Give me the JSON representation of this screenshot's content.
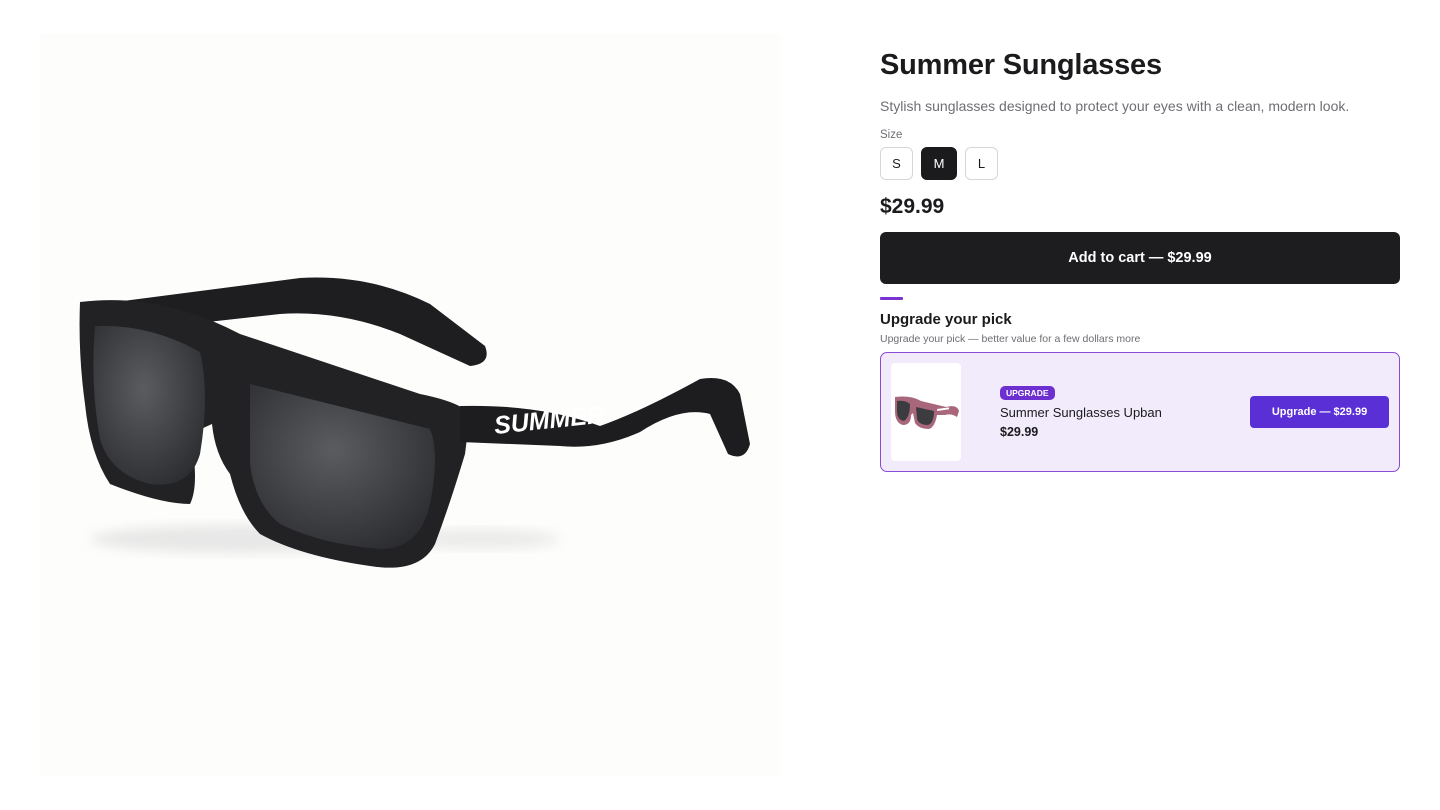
{
  "product": {
    "title": "Summer Sunglasses",
    "description": "Stylish sunglasses designed to protect your eyes with a clean, modern look.",
    "image_icon": "sunglasses-product-image",
    "brand_mark": "SUMMER",
    "size_label": "Size",
    "sizes": [
      "S",
      "M",
      "L"
    ],
    "selected_size": "M",
    "price": "$29.99",
    "add_to_cart_label": "Add to cart — $29.99"
  },
  "upsell": {
    "title": "Upgrade your pick",
    "subtitle": "Upgrade your pick — better value for a few dollars more",
    "badge": "UPGRADE",
    "name": "Summer Sunglasses Upban",
    "price": "$29.99",
    "button_label": "Upgrade — $29.99",
    "thumb_icon": "pink-sunglasses-thumbnail"
  },
  "colors": {
    "primary_button": "#1d1d1f",
    "accent": "#7a34d4",
    "upsell_button": "#5a2fd6",
    "upsell_background": "#f1ebfb",
    "upsell_border": "#8a4ad6"
  }
}
